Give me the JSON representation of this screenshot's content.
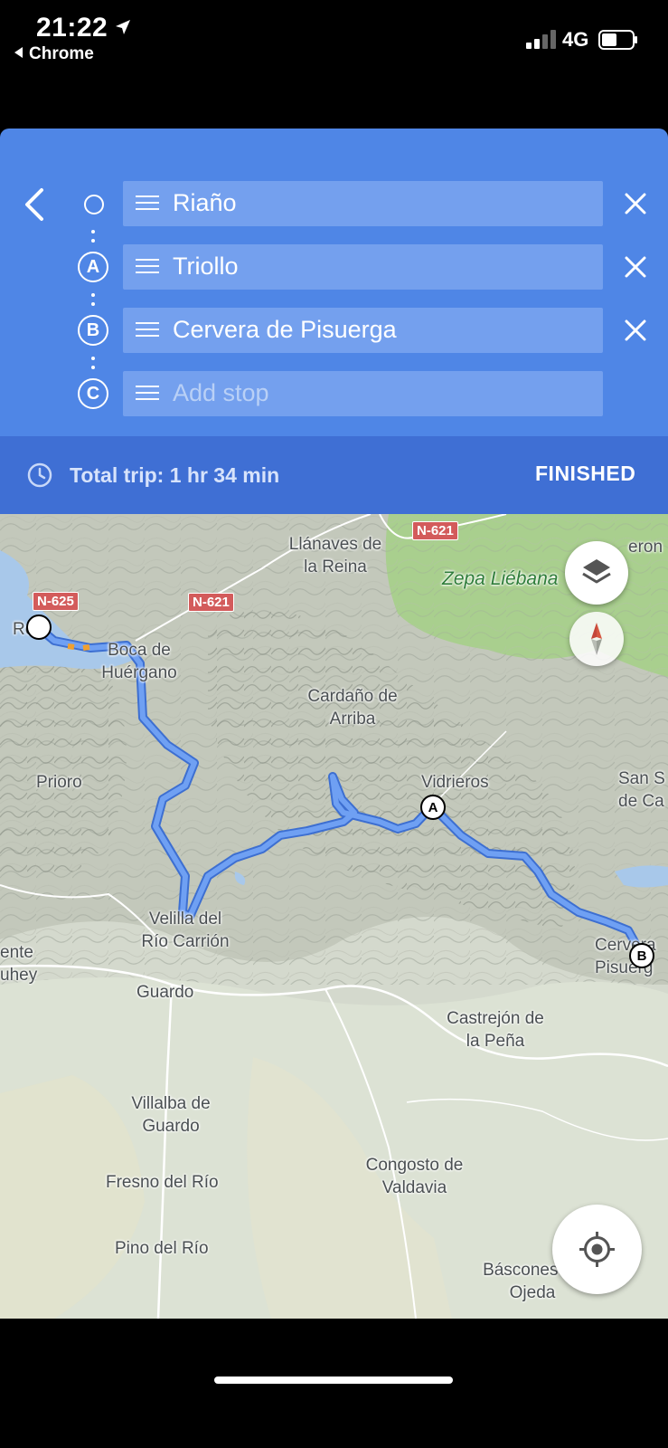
{
  "status_bar": {
    "time": "21:22",
    "back_app": "Chrome",
    "network": "4G"
  },
  "directions": {
    "stops": [
      {
        "marker": "",
        "value": "Riaño"
      },
      {
        "marker": "A",
        "value": "Triollo"
      },
      {
        "marker": "B",
        "value": "Cervera de Pisuerga"
      }
    ],
    "add_stop": {
      "marker": "C",
      "placeholder": "Add stop"
    },
    "total_trip": "Total trip: 1 hr 34 min",
    "finished_label": "FINISHED"
  },
  "map": {
    "road_shields": [
      "N-621",
      "N-625",
      "N-621"
    ],
    "places": [
      "Llánaves de la Reina",
      "Zepa Liébana",
      "Boca de Huérgano",
      "Cardaño de Arriba",
      "Prioro",
      "Vidrieros",
      "San S de Ca",
      "Velilla del Río Carrión",
      "ente uhey",
      "Cervera Pisuerg",
      "Guardo",
      "Castrejón de la Peña",
      "Villalba de Guardo",
      "Congosto de Valdavia",
      "Fresno del Río",
      "Pino del Río",
      "Báscones de Ojeda",
      "Ro o",
      "eron"
    ],
    "route_pins": {
      "a": "A",
      "b": "B"
    },
    "colors": {
      "route": "#5b8ff0",
      "route_outline": "#3d6fd1",
      "park": "#a9cf8e",
      "terrain": "#d8ddd2"
    }
  }
}
